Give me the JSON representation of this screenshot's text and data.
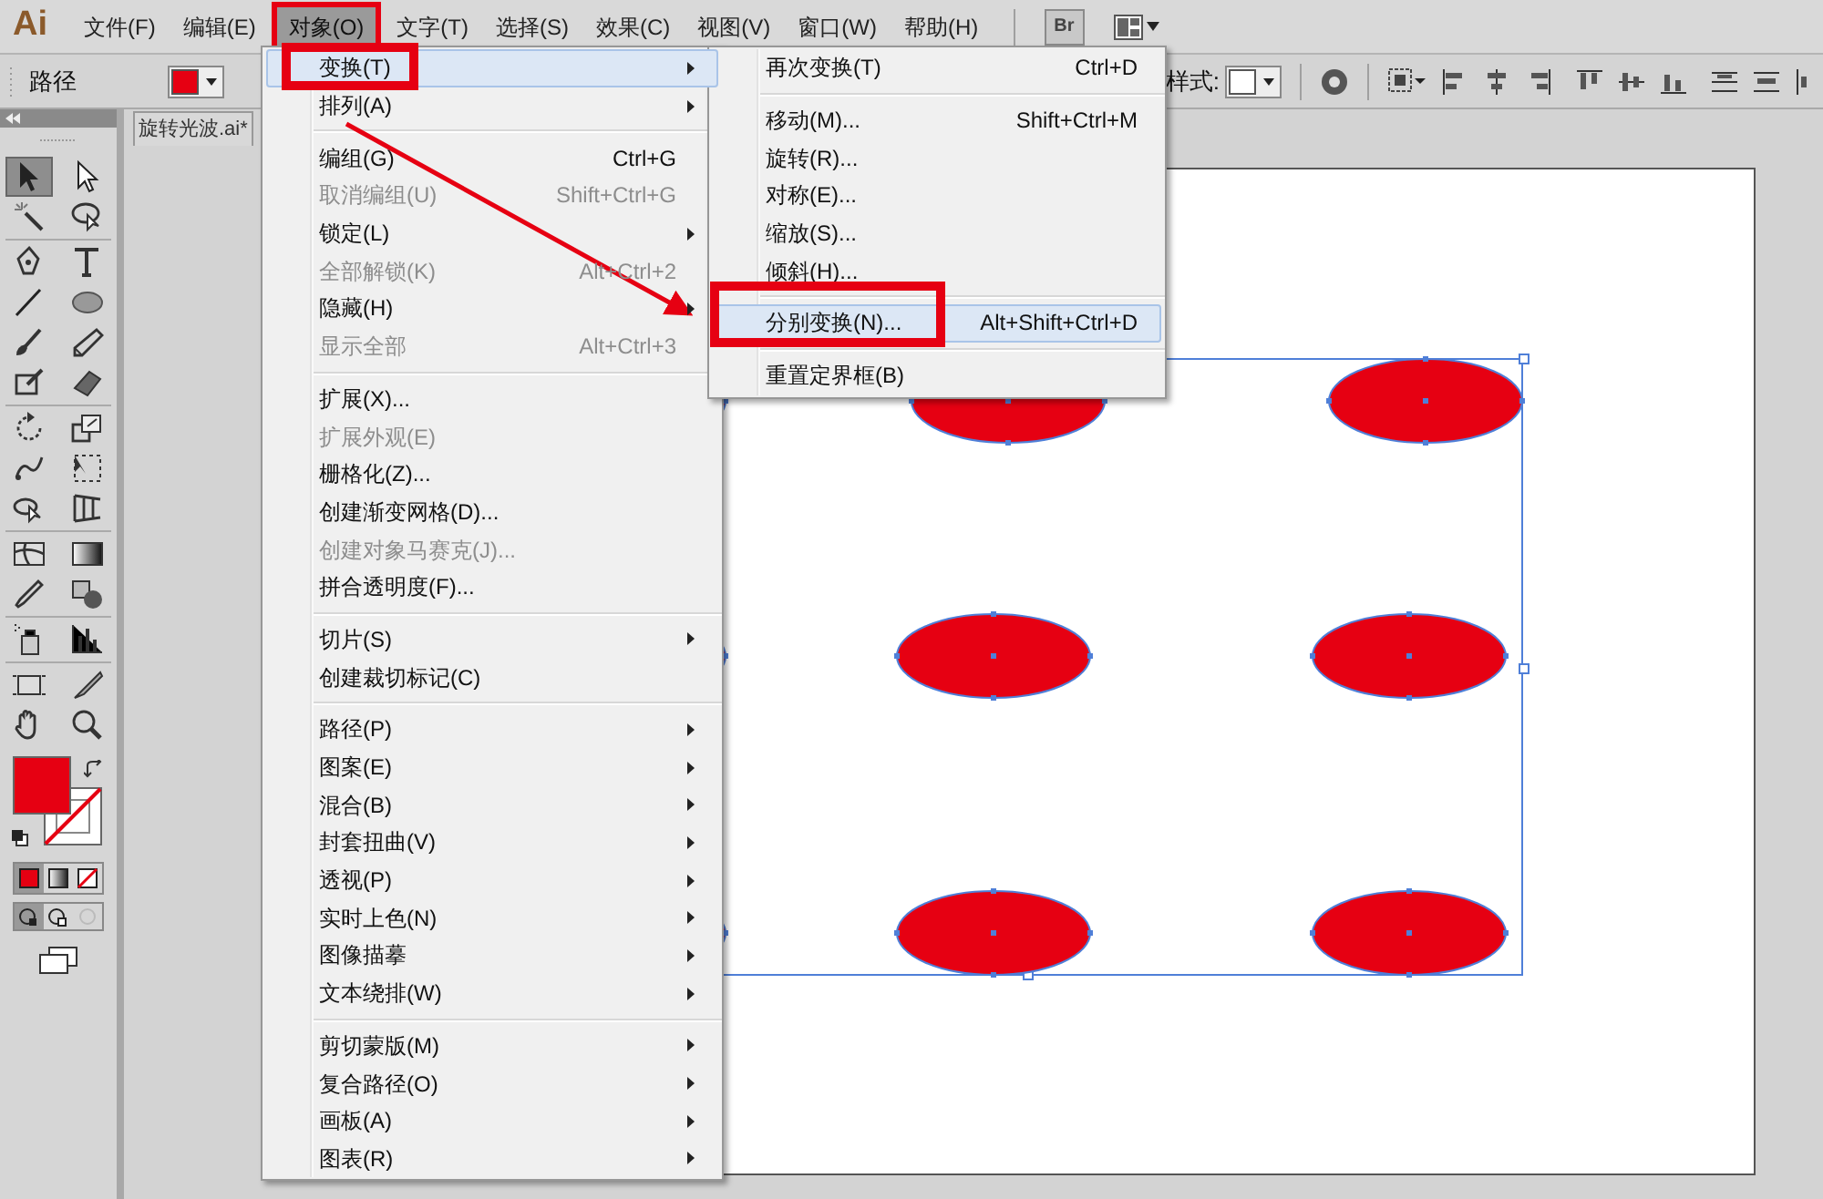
{
  "app": {
    "logo": "Ai"
  },
  "menubar": [
    {
      "label": "文件(F)",
      "selected": false
    },
    {
      "label": "编辑(E)",
      "selected": false
    },
    {
      "label": "对象(O)",
      "selected": true
    },
    {
      "label": "文字(T)",
      "selected": false
    },
    {
      "label": "选择(S)",
      "selected": false
    },
    {
      "label": "效果(C)",
      "selected": false
    },
    {
      "label": "视图(V)",
      "selected": false
    },
    {
      "label": "窗口(W)",
      "selected": false
    },
    {
      "label": "帮助(H)",
      "selected": false
    }
  ],
  "bridge_button": {
    "label": "Br"
  },
  "control_bar": {
    "object_type": "路径",
    "style_label": "样式:"
  },
  "document_tab": {
    "title": "旋转光波.ai*"
  },
  "tools": [
    {
      "kind": "selection",
      "selected": true
    },
    {
      "kind": "direct-selection",
      "selected": false
    },
    {
      "kind": "magic-wand",
      "selected": false
    },
    {
      "kind": "lasso",
      "selected": false
    },
    {
      "kind": "pen",
      "selected": false
    },
    {
      "kind": "type",
      "selected": false
    },
    {
      "kind": "line",
      "selected": false
    },
    {
      "kind": "ellipse",
      "selected": false
    },
    {
      "kind": "brush",
      "selected": false
    },
    {
      "kind": "pencil",
      "selected": false
    },
    {
      "kind": "blob-brush",
      "selected": false
    },
    {
      "kind": "eraser",
      "selected": false
    },
    {
      "kind": "rotate",
      "selected": false
    },
    {
      "kind": "scale",
      "selected": false
    },
    {
      "kind": "warp",
      "selected": false
    },
    {
      "kind": "free-transform",
      "selected": false
    },
    {
      "kind": "shape-builder",
      "selected": false
    },
    {
      "kind": "perspective-grid",
      "selected": false
    },
    {
      "kind": "mesh",
      "selected": false
    },
    {
      "kind": "gradient",
      "selected": false
    },
    {
      "kind": "eyedropper",
      "selected": false
    },
    {
      "kind": "blend",
      "selected": false
    },
    {
      "kind": "symbol-sprayer",
      "selected": false
    },
    {
      "kind": "column-graph",
      "selected": false
    },
    {
      "kind": "artboard",
      "selected": false
    },
    {
      "kind": "slice",
      "selected": false
    },
    {
      "kind": "hand",
      "selected": false
    },
    {
      "kind": "zoom",
      "selected": false
    }
  ],
  "object_menu": {
    "groups": [
      [
        {
          "label": "变换(T)",
          "has_submenu": true,
          "disabled": false,
          "selected": true
        },
        {
          "label": "排列(A)",
          "has_submenu": true,
          "disabled": false,
          "selected": false
        }
      ],
      [
        {
          "label": "编组(G)",
          "shortcut": "Ctrl+G",
          "has_submenu": false,
          "disabled": false,
          "selected": false
        },
        {
          "label": "取消编组(U)",
          "shortcut": "Shift+Ctrl+G",
          "has_submenu": false,
          "disabled": true,
          "selected": false
        },
        {
          "label": "锁定(L)",
          "has_submenu": true,
          "disabled": false,
          "selected": false
        },
        {
          "label": "全部解锁(K)",
          "shortcut": "Alt+Ctrl+2",
          "has_submenu": false,
          "disabled": true,
          "selected": false
        },
        {
          "label": "隐藏(H)",
          "has_submenu": true,
          "disabled": false,
          "selected": false
        },
        {
          "label": "显示全部",
          "shortcut": "Alt+Ctrl+3",
          "has_submenu": false,
          "disabled": true,
          "selected": false
        }
      ],
      [
        {
          "label": "扩展(X)...",
          "has_submenu": false,
          "disabled": false,
          "selected": false
        },
        {
          "label": "扩展外观(E)",
          "has_submenu": false,
          "disabled": true,
          "selected": false
        },
        {
          "label": "栅格化(Z)...",
          "has_submenu": false,
          "disabled": false,
          "selected": false
        },
        {
          "label": "创建渐变网格(D)...",
          "has_submenu": false,
          "disabled": false,
          "selected": false
        },
        {
          "label": "创建对象马赛克(J)...",
          "has_submenu": false,
          "disabled": true,
          "selected": false
        },
        {
          "label": "拼合透明度(F)...",
          "has_submenu": false,
          "disabled": false,
          "selected": false
        }
      ],
      [
        {
          "label": "切片(S)",
          "has_submenu": true,
          "disabled": false,
          "selected": false
        },
        {
          "label": "创建裁切标记(C)",
          "has_submenu": false,
          "disabled": false,
          "selected": false
        }
      ],
      [
        {
          "label": "路径(P)",
          "has_submenu": true,
          "disabled": false,
          "selected": false
        },
        {
          "label": "图案(E)",
          "has_submenu": true,
          "disabled": false,
          "selected": false
        },
        {
          "label": "混合(B)",
          "has_submenu": true,
          "disabled": false,
          "selected": false
        },
        {
          "label": "封套扭曲(V)",
          "has_submenu": true,
          "disabled": false,
          "selected": false
        },
        {
          "label": "透视(P)",
          "has_submenu": true,
          "disabled": false,
          "selected": false
        },
        {
          "label": "实时上色(N)",
          "has_submenu": true,
          "disabled": false,
          "selected": false
        },
        {
          "label": "图像描摹",
          "has_submenu": true,
          "disabled": false,
          "selected": false
        },
        {
          "label": "文本绕排(W)",
          "has_submenu": true,
          "disabled": false,
          "selected": false
        }
      ],
      [
        {
          "label": "剪切蒙版(M)",
          "has_submenu": true,
          "disabled": false,
          "selected": false
        },
        {
          "label": "复合路径(O)",
          "has_submenu": true,
          "disabled": false,
          "selected": false
        },
        {
          "label": "画板(A)",
          "has_submenu": true,
          "disabled": false,
          "selected": false
        },
        {
          "label": "图表(R)",
          "has_submenu": true,
          "disabled": false,
          "selected": false
        }
      ]
    ]
  },
  "transform_submenu": {
    "groups": [
      [
        {
          "label": "再次变换(T)",
          "shortcut": "Ctrl+D",
          "selected": false
        }
      ],
      [
        {
          "label": "移动(M)...",
          "shortcut": "Shift+Ctrl+M",
          "selected": false
        },
        {
          "label": "旋转(R)...",
          "selected": false
        },
        {
          "label": "对称(E)...",
          "selected": false
        },
        {
          "label": "缩放(S)...",
          "selected": false
        },
        {
          "label": "倾斜(H)...",
          "selected": false
        }
      ],
      [
        {
          "label": "分别变换(N)...",
          "shortcut": "Alt+Shift+Ctrl+D",
          "selected": true
        }
      ],
      [
        {
          "label": "重置定界框(B)",
          "selected": false
        }
      ]
    ]
  }
}
